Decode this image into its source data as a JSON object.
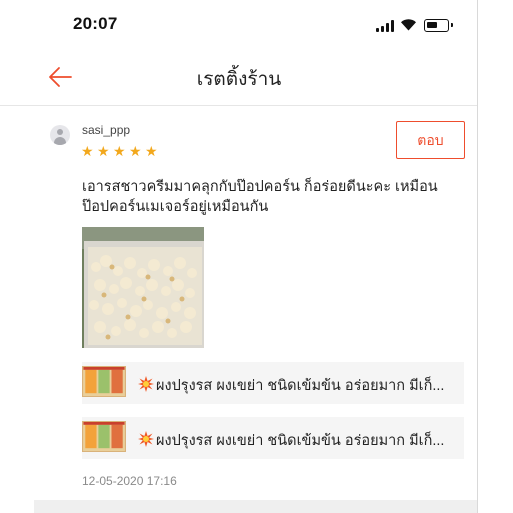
{
  "status_bar": {
    "time": "20:07"
  },
  "header": {
    "title": "เรตติ้งร้าน"
  },
  "review": {
    "username": "sasi_ppp",
    "rating": 5,
    "stars": [
      "★",
      "★",
      "★",
      "★",
      "★"
    ],
    "reply_label": "ตอบ",
    "text": "เอารสชาวครีมมาคลุกกับป๊อปคอร์น ก็อร่อยดีนะคะ เหมือน ป๊อปคอร์นเมเจอร์อยู่เหมือนกัน",
    "timestamp": "12-05-2020 17:16"
  },
  "products": [
    {
      "name": "ผงปรุงรส ผงเขย่า ชนิดเข้มข้น อร่อยมาก มีเก็...",
      "icon": "burst-icon"
    },
    {
      "name": "ผงปรุงรส ผงเขย่า ชนิดเข้มข้น อร่อยมาก มีเก็...",
      "icon": "burst-icon"
    }
  ],
  "colors": {
    "accent": "#ee4d2d",
    "star": "#f2a81d",
    "card_bg": "#f5f5f5"
  }
}
